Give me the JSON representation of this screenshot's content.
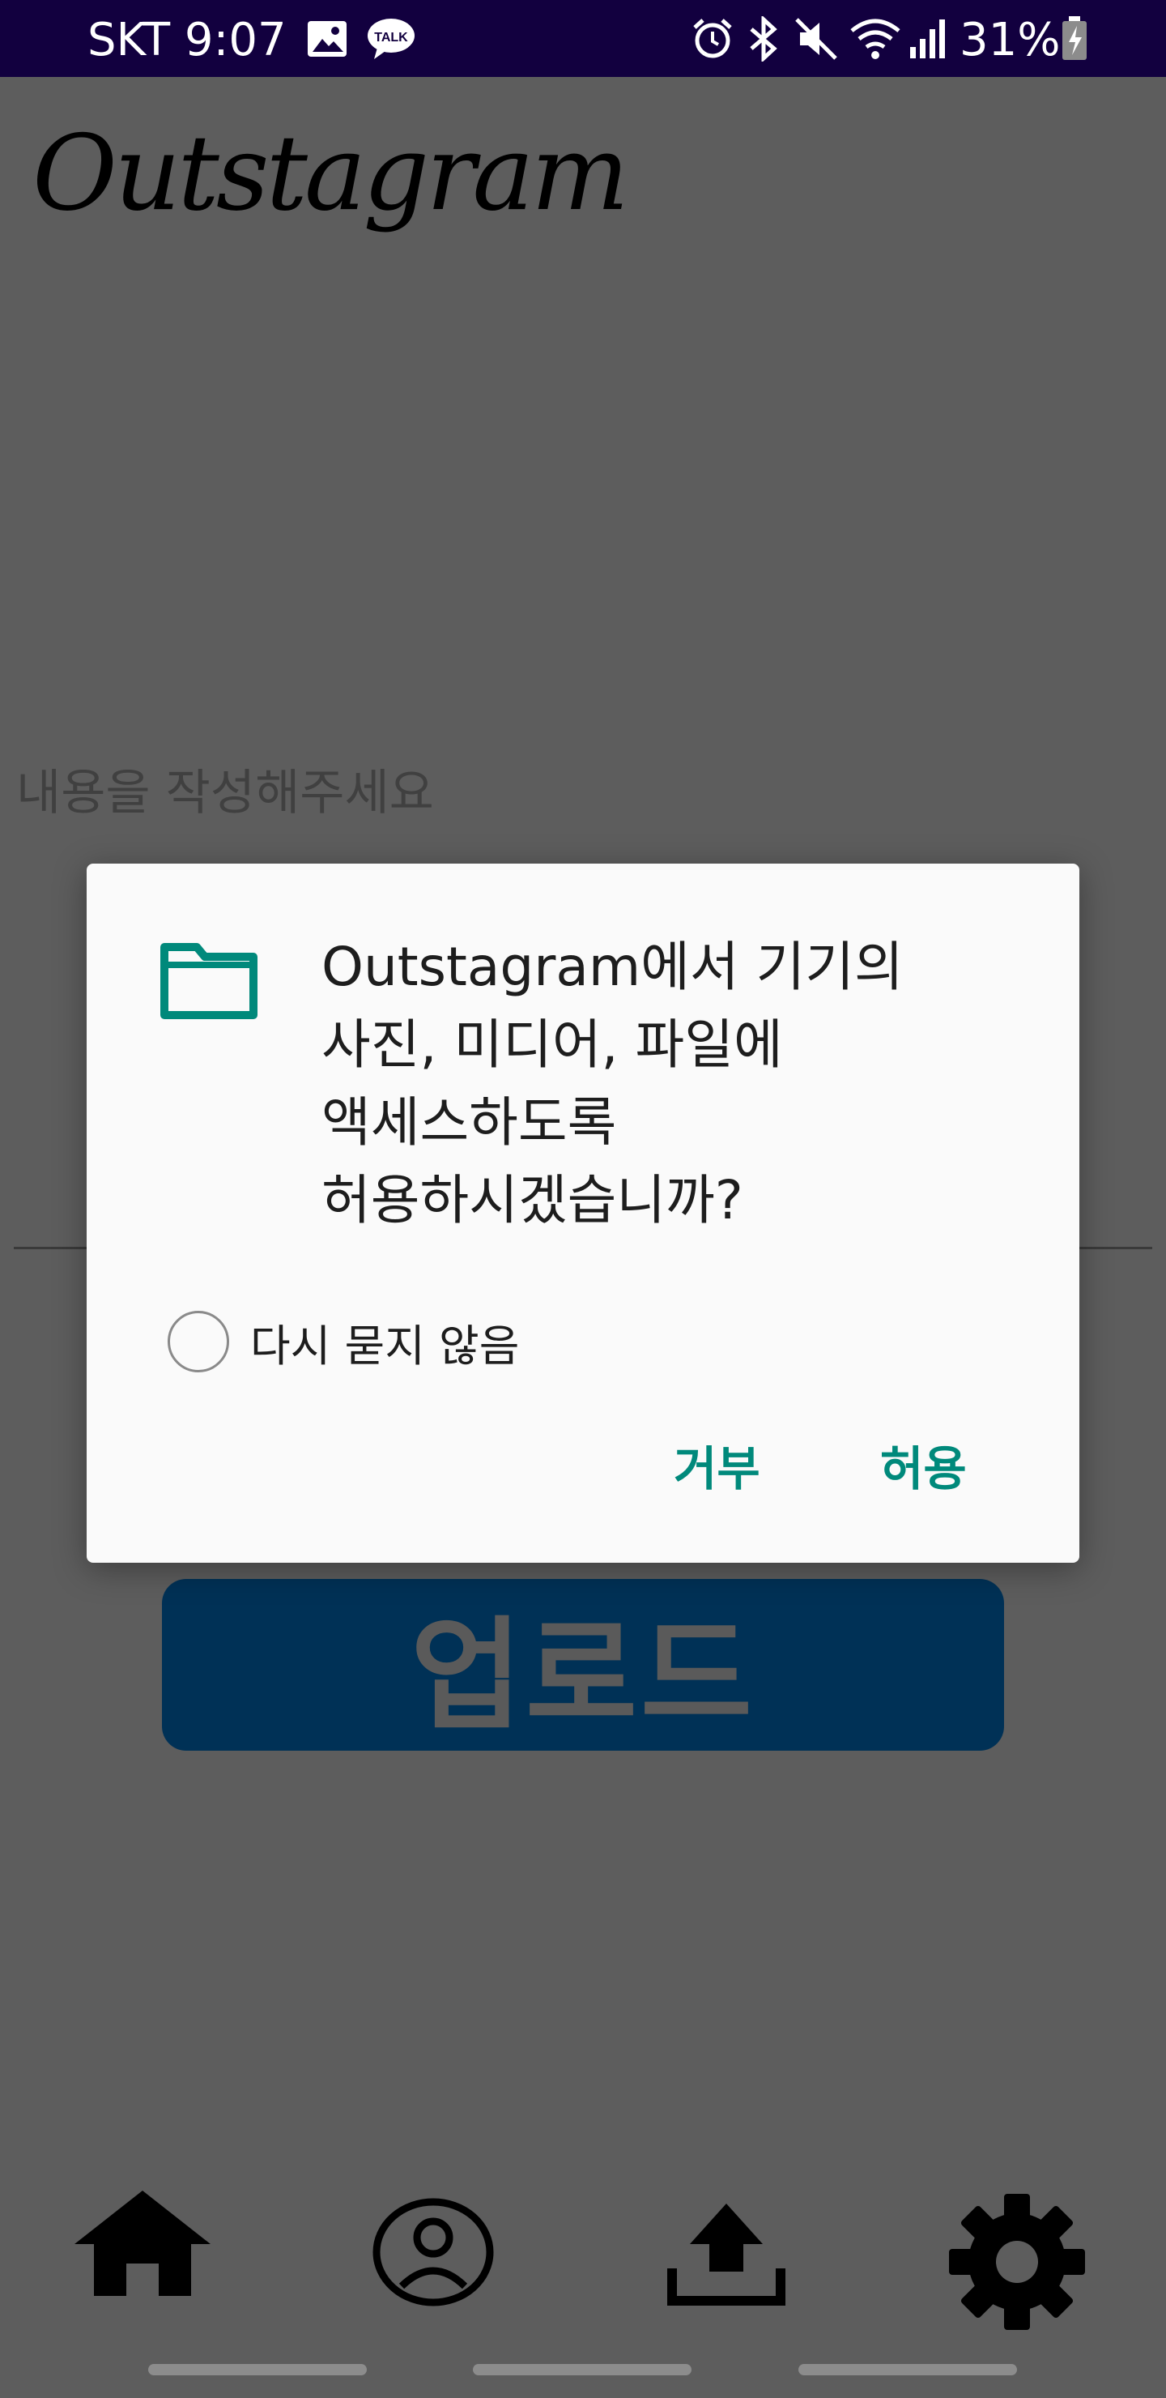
{
  "status_bar": {
    "carrier_time": "SKT 9:07",
    "battery_percent": "31%",
    "icons": [
      "image-icon",
      "talk-icon",
      "alarm-icon",
      "bluetooth-icon",
      "mute-icon",
      "wifi-icon",
      "signal-icon",
      "battery-icon"
    ]
  },
  "app": {
    "logo": "Outstagram",
    "content_placeholder": "내용을 작성해주세요",
    "upload_button": "업로드"
  },
  "dialog": {
    "message_lines": [
      "Outstagram에서 기기의",
      "사진, 미디어, 파일에",
      "액세스하도록",
      "허용하시겠습니까?"
    ],
    "dont_ask_again": "다시 묻지 않음",
    "deny": "거부",
    "allow": "허용",
    "accent_color": "#00897b"
  },
  "bottom_nav": {
    "items": [
      "home-icon",
      "profile-icon",
      "upload-icon",
      "settings-icon"
    ]
  }
}
